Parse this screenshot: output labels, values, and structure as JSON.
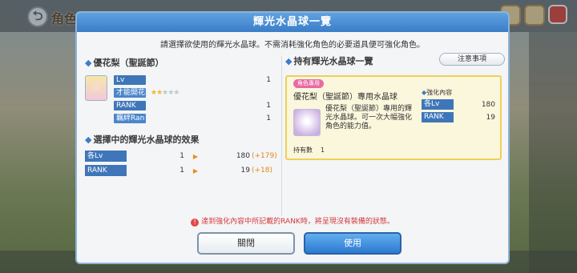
{
  "background": {
    "title": "角色",
    "back_icon": "back-arrow-icon"
  },
  "modal": {
    "title": "輝光水晶球一覽",
    "instruction": "請選擇欲使用的輝光水晶球。不需消耗強化角色的必要道具便可強化角色。",
    "character": {
      "name": "優花梨（聖誕節）",
      "stats": [
        {
          "label": "Lv",
          "value": "1"
        },
        {
          "label": "才能開花",
          "stars_filled": 2,
          "stars_total": 5
        },
        {
          "label": "RANK",
          "value": "1"
        },
        {
          "label": "羈絆Ran",
          "value": "1"
        }
      ]
    },
    "effect": {
      "title": "選擇中的輝光水晶球的效果",
      "rows": [
        {
          "label": "各Lv",
          "current": "1",
          "new": "180",
          "plus": "(+179)"
        },
        {
          "label": "RANK",
          "current": "1",
          "new": "19",
          "plus": "(+18)"
        }
      ]
    },
    "owned": {
      "title": "持有輝光水晶球一覽",
      "notice_button": "注意事項",
      "orb": {
        "tag": "角色專用",
        "name": "優花梨（聖誕節）專用水晶球",
        "description": "優花梨（聖誕節）專用的輝光水晶球。可一次大幅強化角色的能力值。",
        "count_label": "持有數",
        "count": "1",
        "enhance_title": "強化內容",
        "enhance": [
          {
            "label": "各Lv",
            "value": "180"
          },
          {
            "label": "RANK",
            "value": "19"
          }
        ]
      }
    },
    "warning": "達到強化內容中所記載的RANK時，將呈現沒有裝備的狀態。",
    "buttons": {
      "close": "關閉",
      "use": "使用"
    }
  }
}
